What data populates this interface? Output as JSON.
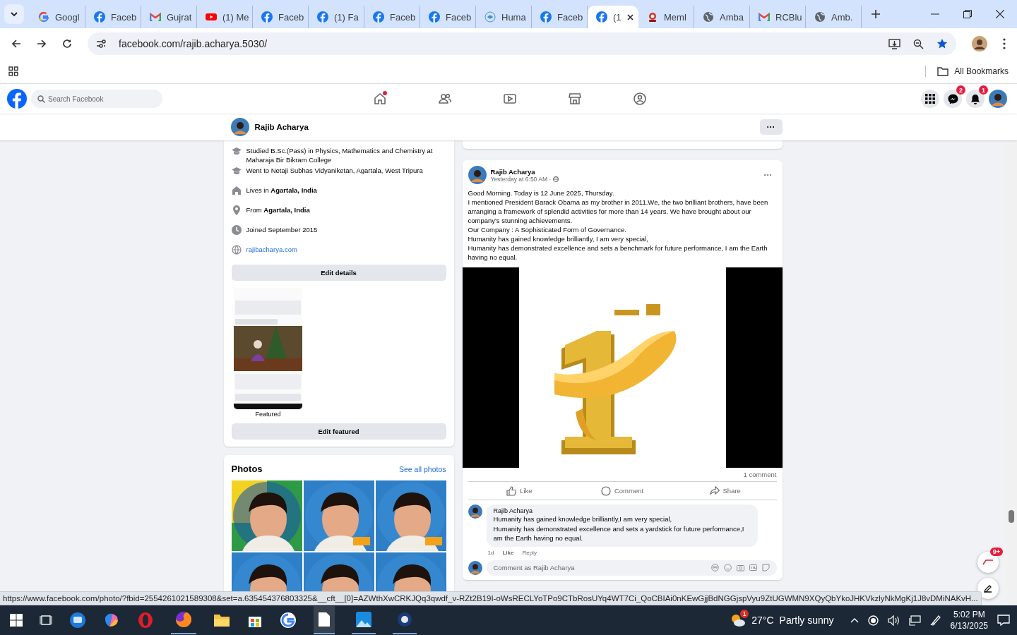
{
  "browser": {
    "tabs": [
      {
        "title": "Googl",
        "kind": "google",
        "selected": false
      },
      {
        "title": "Faceb",
        "kind": "facebook",
        "selected": false
      },
      {
        "title": "Gujrat",
        "kind": "mail",
        "selected": false
      },
      {
        "title": "(1) Me",
        "kind": "video",
        "selected": false
      },
      {
        "title": "Faceb",
        "kind": "facebook",
        "selected": false
      },
      {
        "title": "(1) Fa",
        "kind": "facebook",
        "selected": false
      },
      {
        "title": "Faceb",
        "kind": "facebook",
        "selected": false
      },
      {
        "title": "Faceb",
        "kind": "facebook",
        "selected": false
      },
      {
        "title": "Huma",
        "kind": "emblem",
        "selected": false
      },
      {
        "title": "Faceb",
        "kind": "facebook",
        "selected": false
      },
      {
        "title": "(1",
        "kind": "facebook",
        "selected": true
      },
      {
        "title": "Meml",
        "kind": "member",
        "selected": false
      },
      {
        "title": "Amba",
        "kind": "globe",
        "selected": false
      },
      {
        "title": "RCBlu",
        "kind": "mail",
        "selected": false
      },
      {
        "title": "Amb.",
        "kind": "globe",
        "selected": false
      }
    ],
    "address": "facebook.com/rajib.acharya.5030/",
    "bookmarks_label": "All Bookmarks",
    "status_url": "https://www.facebook.com/photo/?fbid=2554261021589308&set=a.635454376803325&__cft__[0]=AZWthXwCRKJQq3qwdf_v-RZt2B19I-oWsRECLYoTPo9CTbRosUYq4WT7Ci_QoCBIAi0nKEwGjjBdNGGjspVyu9ZtUGWMN9XQyQbYkoJHKVkzlyNkMgKj1J8vDMiNAKvH..."
  },
  "facebook": {
    "search_placeholder": "Search Facebook",
    "nav": [
      {
        "kind": "home",
        "selected": true
      },
      {
        "kind": "friends",
        "selected": false
      },
      {
        "kind": "video",
        "selected": false
      },
      {
        "kind": "market",
        "selected": false
      },
      {
        "kind": "groups",
        "selected": false
      }
    ],
    "messenger_badge": "2",
    "notifications_badge": "1"
  },
  "profile_bar": {
    "name": "Rajib Acharya",
    "more": "···"
  },
  "intro": {
    "items": [
      {
        "kind": "study",
        "text": "Studied B.Sc.(Pass) in Physics, Mathematics and Chemistry at Maharaja Bir Bikram College"
      },
      {
        "kind": "study",
        "text": "Went to Netaji Subhas Vidyaniketan, Agartala, West Tripura"
      },
      {
        "kind": "home",
        "text": "Lives in **Agartala, India**"
      },
      {
        "kind": "pin",
        "text": "From **Agartala, India**"
      },
      {
        "kind": "clock",
        "text": "Joined September 2015"
      },
      {
        "kind": "link",
        "text": "rajibacharya.com"
      }
    ],
    "edit_details": "Edit details",
    "featured_label": "Featured",
    "edit_featured": "Edit featured"
  },
  "photos": {
    "title": "Photos",
    "see_all": "See all photos"
  },
  "post": {
    "author": "Rajib Acharya",
    "time": "Yesterday at 6:50 AM ·",
    "more": "···",
    "lines": [
      "Good Morning. Today is 12 June 2025, Thursday.",
      "I mentioned President Barack Obama as my brother in 2011.We, the two brilliant brothers, have been arranging a framework of splendid activities for more than 14 years. We have brought about our company's stunning achievements.",
      "Our Company : A Sophisticated Form of Governance.",
      "Humanity has gained knowledge brilliantly, I am very special,",
      "Humanity has demonstrated excellence and sets a benchmark for future performance, I am the Earth having no equal."
    ],
    "comment_count": "1 comment",
    "actions": [
      {
        "kind": "like",
        "label": "Like"
      },
      {
        "kind": "comment",
        "label": "Comment"
      },
      {
        "kind": "share",
        "label": "Share"
      }
    ],
    "comment": {
      "author": "Rajib Acharya",
      "lines": [
        "Humanity has gained knowledge brilliantly,I am very special,",
        "Humanity has demonstrated excellence and sets a yardstick for future performance,I am the Earth having no equal."
      ],
      "age": "1d",
      "like": "Like",
      "reply": "Reply"
    },
    "comment_placeholder": "Comment as Rajib Acharya"
  },
  "news_badge": "9+",
  "taskbar": {
    "weather_badge": "1",
    "temperature": "27°C",
    "condition": "Partly sunny",
    "time": "5:02 PM",
    "date": "6/13/2025"
  }
}
